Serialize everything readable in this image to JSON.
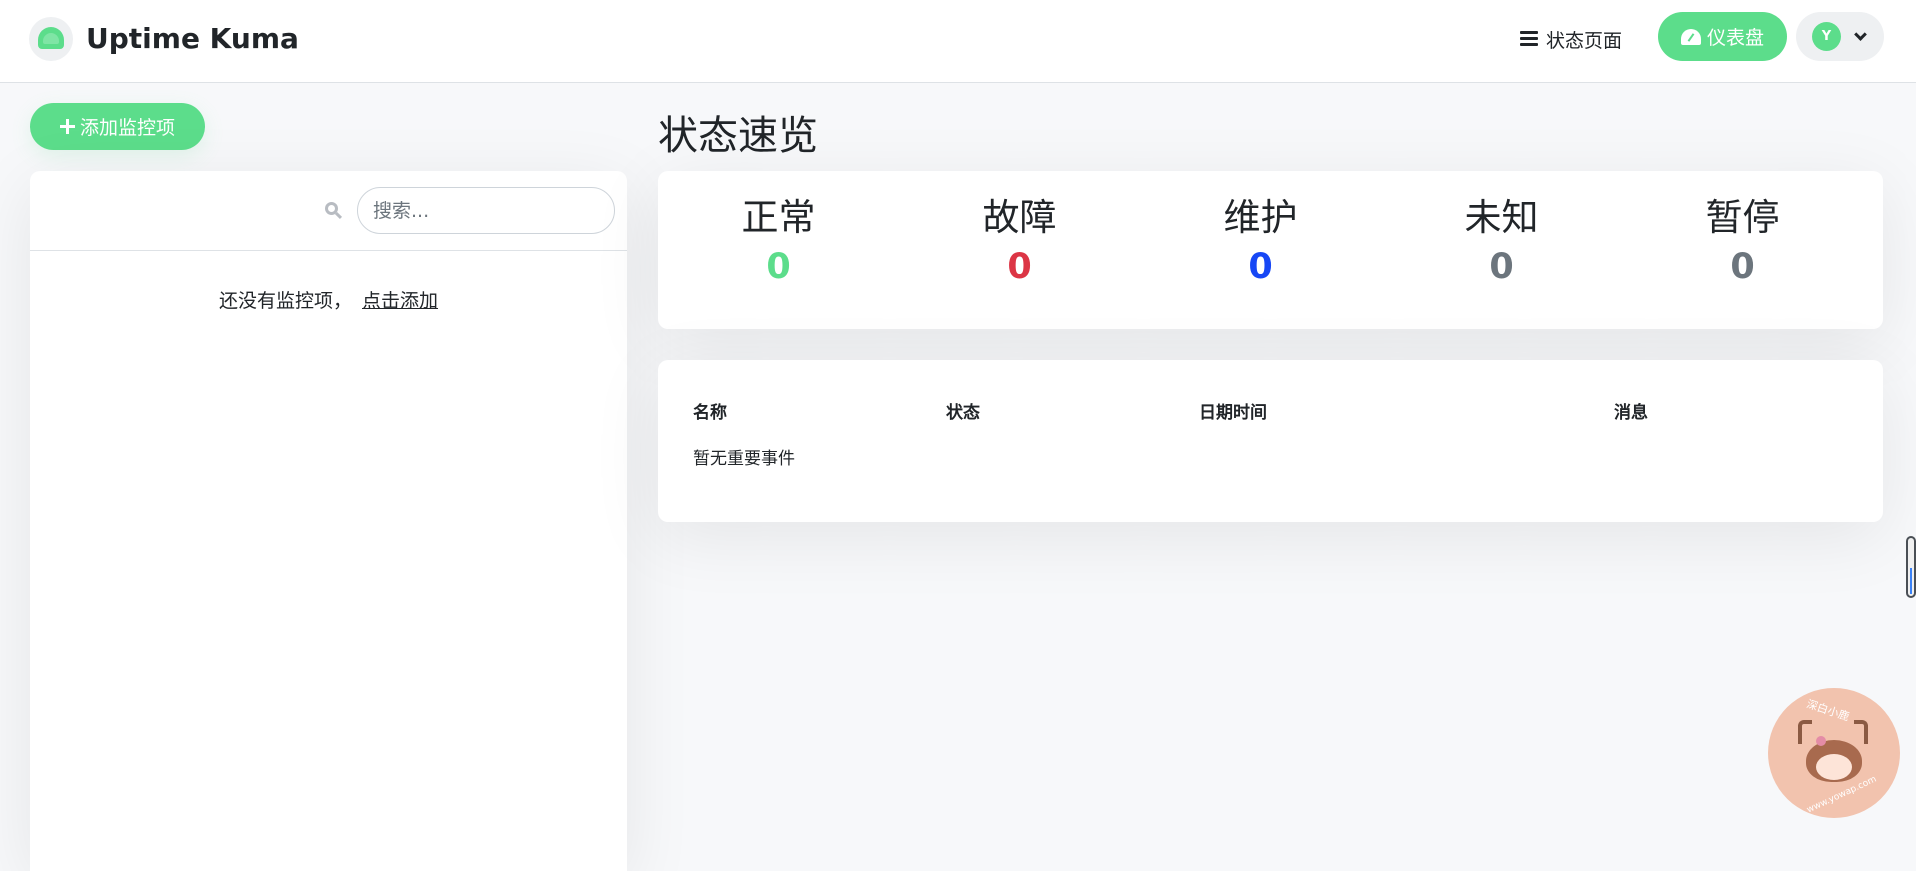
{
  "header": {
    "app_title": "Uptime Kuma",
    "status_page_label": "状态页面",
    "dashboard_label": "仪表盘",
    "avatar_initial": "Y"
  },
  "sidebar": {
    "add_monitor_label": "添加监控项",
    "search_placeholder": "搜索...",
    "empty_text": "还没有监控项，",
    "empty_link": "点击添加"
  },
  "main": {
    "title": "状态速览",
    "stats": [
      {
        "label": "正常",
        "value": "0",
        "color": "#5cdd8b"
      },
      {
        "label": "故障",
        "value": "0",
        "color": "#dc3545"
      },
      {
        "label": "维护",
        "value": "0",
        "color": "#1747f5"
      },
      {
        "label": "未知",
        "value": "0",
        "color": "#6c757d"
      },
      {
        "label": "暂停",
        "value": "0",
        "color": "#6c757d"
      }
    ],
    "events": {
      "columns": [
        "名称",
        "状态",
        "日期时间",
        "消息"
      ],
      "empty_text": "暂无重要事件"
    }
  },
  "watermark": {
    "text_top": "深白小鹿",
    "text_bottom": "www.yowap.com"
  },
  "colors": {
    "accent": "#5cdd8b",
    "danger": "#dc3545",
    "maintenance": "#1747f5",
    "muted": "#6c757d"
  }
}
